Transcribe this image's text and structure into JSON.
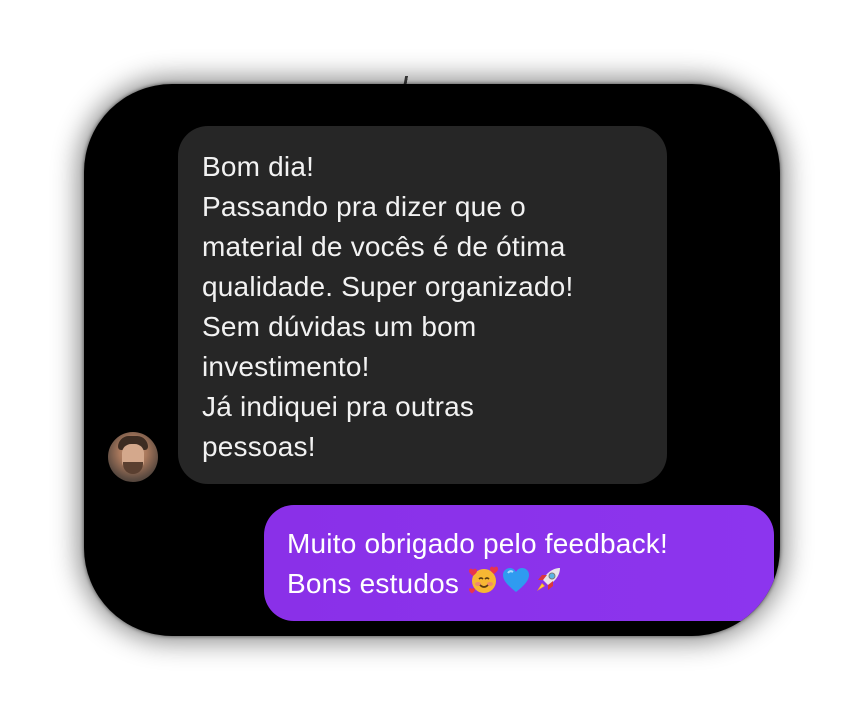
{
  "chat": {
    "incoming": {
      "lines": [
        "Bom dia!",
        "Passando pra dizer que o",
        "material de vocês é de ótima",
        "qualidade. Super organizado!",
        "Sem dúvidas um bom",
        "investimento!",
        "Já indiquei pra outras",
        "pessoas!"
      ]
    },
    "outgoing": {
      "line1": "Muito obrigado pelo feedback!",
      "line2": "Bons estudos"
    },
    "emojis": [
      "smiling-face-with-hearts",
      "blue-heart",
      "rocket"
    ],
    "colors": {
      "background": "#000000",
      "incoming_bubble": "#262626",
      "outgoing_bubble": "#8a30e8",
      "text": "#ffffff"
    }
  }
}
